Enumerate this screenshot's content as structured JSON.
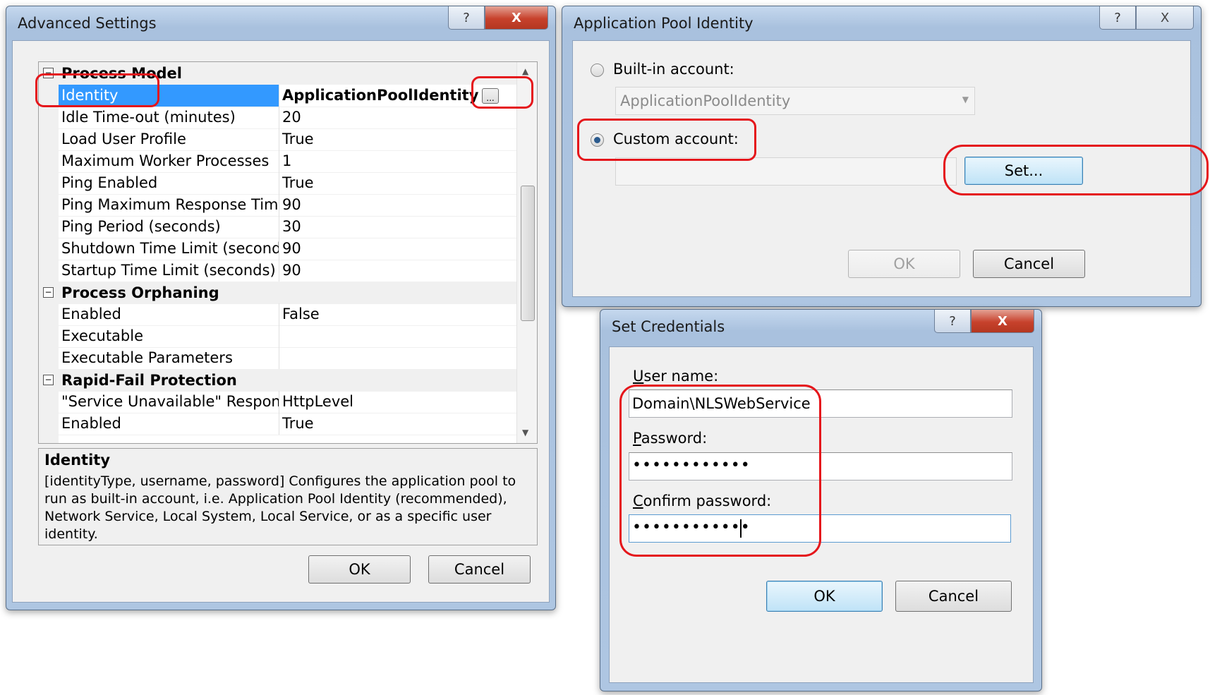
{
  "advanced_settings": {
    "title": "Advanced Settings",
    "help_glyph": "?",
    "close_glyph": "X",
    "categories": [
      {
        "label": "Process Model",
        "expander": "⊟"
      },
      {
        "label": "Process Orphaning",
        "expander": "⊟"
      },
      {
        "label": "Rapid-Fail Protection",
        "expander": "⊟"
      }
    ],
    "rows": [
      {
        "name": "Identity",
        "value": "ApplicationPoolIdentity"
      },
      {
        "name": "Idle Time-out (minutes)",
        "value": "20"
      },
      {
        "name": "Load User Profile",
        "value": "True"
      },
      {
        "name": "Maximum Worker Processes",
        "value": "1"
      },
      {
        "name": "Ping Enabled",
        "value": "True"
      },
      {
        "name": "Ping Maximum Response Time (s",
        "value": "90"
      },
      {
        "name": "Ping Period (seconds)",
        "value": "30"
      },
      {
        "name": "Shutdown Time Limit (seconds)",
        "value": "90"
      },
      {
        "name": "Startup Time Limit (seconds)",
        "value": "90"
      },
      {
        "name": "Enabled",
        "value": "False"
      },
      {
        "name": "Executable",
        "value": ""
      },
      {
        "name": "Executable Parameters",
        "value": ""
      },
      {
        "name": "\"Service Unavailable\" Response T",
        "value": "HttpLevel"
      },
      {
        "name": "Enabled",
        "value": "True"
      }
    ],
    "ellipsis_button": "...",
    "description_title": "Identity",
    "description_text": "[identityType, username, password] Configures the application pool to run as built-in account, i.e. Application Pool Identity (recommended), Network Service, Local System, Local Service, or as a specific user identity.",
    "ok": "OK",
    "cancel": "Cancel"
  },
  "app_pool_identity": {
    "title": "Application Pool Identity",
    "help_glyph": "?",
    "close_glyph": "X",
    "builtin_label": "Built-in account:",
    "builtin_value": "ApplicationPoolIdentity",
    "custom_label": "Custom account:",
    "custom_value": "",
    "set_button": "Set...",
    "ok": "OK",
    "cancel": "Cancel",
    "selected": "custom"
  },
  "set_credentials": {
    "title": "Set Credentials",
    "help_glyph": "?",
    "close_glyph": "X",
    "username_label_key": "U",
    "username_label_rest": "ser name:",
    "username_value": "Domain\\NLSWebService",
    "password_label_key": "P",
    "password_label_rest": "assword:",
    "password_value": "••••••••••••",
    "confirm_label_key": "C",
    "confirm_label_rest": "onfirm password:",
    "confirm_value": "••••••••••••",
    "ok": "OK",
    "cancel": "Cancel"
  },
  "colors": {
    "annotation": "#e5161b",
    "selection": "#3399ff"
  }
}
